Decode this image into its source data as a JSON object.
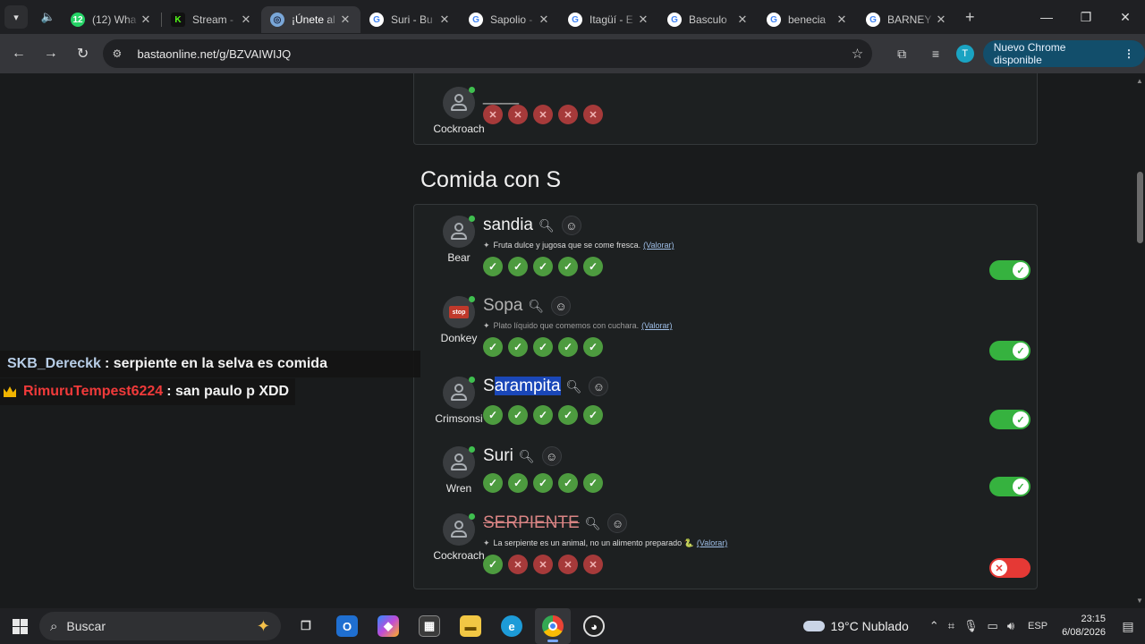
{
  "browser": {
    "tabs": [
      {
        "title": "(12) Wha",
        "fav_text": "12",
        "fav_color": "#25d366",
        "active": false
      },
      {
        "title": "Stream -",
        "fav_text": "K",
        "fav_color": "#53fc18",
        "active": false
      },
      {
        "title": "¡Únete al",
        "fav_text": "",
        "fav_color": "#7aa7d8",
        "active": true
      },
      {
        "title": "Suri - Bu",
        "fav_text": "G",
        "fav_color": "#ffffff",
        "active": false
      },
      {
        "title": "Sapolio -",
        "fav_text": "G",
        "fav_color": "#ffffff",
        "active": false
      },
      {
        "title": "Itagüí - E",
        "fav_text": "G",
        "fav_color": "#ffffff",
        "active": false
      },
      {
        "title": "Basculo",
        "fav_text": "G",
        "fav_color": "#ffffff",
        "active": false
      },
      {
        "title": "benecia",
        "fav_text": "G",
        "fav_color": "#ffffff",
        "active": false
      },
      {
        "title": "BARNEY",
        "fav_text": "G",
        "fav_color": "#ffffff",
        "active": false
      }
    ],
    "url": "bastaonline.net/g/BZVAIWIJQ",
    "profile_initial": "T",
    "update_label": "Nuevo Chrome disponible"
  },
  "page": {
    "prev_row": {
      "player": "Cockroach",
      "word": "____"
    },
    "section_title": "Comida con S",
    "rows": [
      {
        "player": "Bear",
        "word_pre": "sandia",
        "word_hl": "",
        "word_post": "",
        "hint": "Fruta dulce y jugosa que se come fresca.",
        "valorar": "(Valorar)",
        "toggle": "on"
      },
      {
        "player": "Donkey",
        "word_pre": "Sopa",
        "word_hl": "",
        "word_post": "",
        "hint": "Plato líquido que comemos con cuchara.",
        "valorar": "(Valorar)",
        "toggle": "on"
      },
      {
        "player": "Crimsonsi",
        "word_pre": "S",
        "word_hl": "arampita",
        "word_post": "",
        "hint": "",
        "valorar": "",
        "toggle": "on"
      },
      {
        "player": "Wren",
        "word_pre": "Suri",
        "word_hl": "",
        "word_post": "",
        "hint": "",
        "valorar": "",
        "toggle": "on"
      },
      {
        "player": "Cockroach",
        "word_pre": "SERPIENTE",
        "word_hl": "",
        "word_post": "",
        "hint": "La serpiente es un animal, no un alimento preparado 🐍",
        "valorar": "(Valorar)",
        "toggle": "off"
      }
    ],
    "stop_badge": "stop"
  },
  "chat": [
    {
      "user": "SKB_Dereckk",
      "message": ": serpiente en la selva es comida"
    },
    {
      "user": "RimuruTempest6224",
      "message": ": san paulo p XDD"
    }
  ],
  "taskbar": {
    "search_label": "Buscar",
    "weather": "19°C Nublado",
    "lang": "ESP",
    "time": "23:15",
    "date": "6/08/2026"
  },
  "colors": {
    "accept": "#36b23f",
    "reject": "#e53935",
    "vote_ok": "#4d9b3f",
    "vote_no": "#a63a3a"
  }
}
